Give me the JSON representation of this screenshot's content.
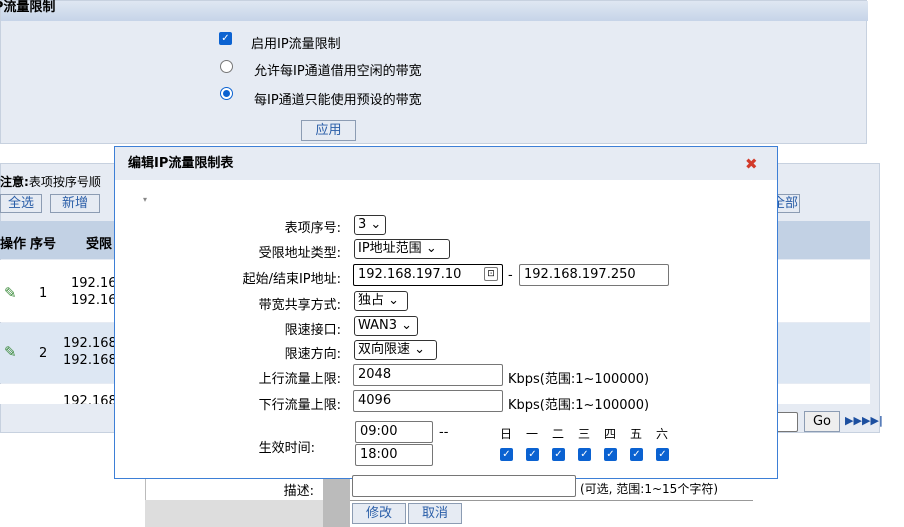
{
  "page": {
    "section_title": "IP流量限制",
    "enable_label": "启用IP流量限制",
    "allow_borrow_label": "允许每IP通道借用空闲的带宽",
    "only_preset_label": "每IP通道只能使用预设的带宽",
    "apply_label": "应用",
    "note_label": "注意:",
    "note_text": "表项按序号顺",
    "select_all_label": "全选",
    "add_label": "新增",
    "delete_all_partial": "全部",
    "col_op": "操作",
    "col_no": "序号",
    "col_addr": "受限",
    "rows": [
      {
        "no": "1",
        "addr1": "192.16",
        "addr2": "192.16"
      },
      {
        "no": "2",
        "addr1": "192.168",
        "addr2": "192.168"
      }
    ],
    "row3_partial": "192.168",
    "go_label": "Go",
    "next_icon": "next-page-icon",
    "last_icon": "last-page-icon",
    "edit_icon": "pencil-icon"
  },
  "dialog": {
    "title": "编辑IP流量限制表",
    "close_icon": "close-icon",
    "mark": "▾",
    "fields": {
      "index_label": "表项序号:",
      "index_value": "3",
      "addr_type_label": "受限地址类型:",
      "addr_type_value": "IP地址范围",
      "ip_range_label": "起始/结束IP地址:",
      "ip_start": "192.168.197.10",
      "ip_sep": "-",
      "ip_end": "192.168.197.250",
      "share_label": "带宽共享方式:",
      "share_value": "独占",
      "iface_label": "限速接口:",
      "iface_value": "WAN3",
      "dir_label": "限速方向:",
      "dir_value": "双向限速",
      "up_label": "上行流量上限:",
      "up_value": "2048",
      "up_unit": "Kbps(范围:1~100000)",
      "down_label": "下行流量上限:",
      "down_value": "4096",
      "down_unit": "Kbps(范围:1~100000)",
      "time_label": "生效时间:",
      "time_start": "09:00",
      "time_sep": "--",
      "time_end": "18:00",
      "days": [
        "日",
        "一",
        "二",
        "三",
        "四",
        "五",
        "六"
      ],
      "desc_label": "描述:",
      "desc_value": "",
      "desc_hint": "(可选, 范围:1~15个字符)",
      "modify_label": "修改",
      "cancel_label": "取消"
    }
  },
  "colors": {
    "accent": "#0b62d1",
    "panel": "#e6ebf3",
    "header": "#c2d1e4",
    "close": "#d23a2a"
  }
}
